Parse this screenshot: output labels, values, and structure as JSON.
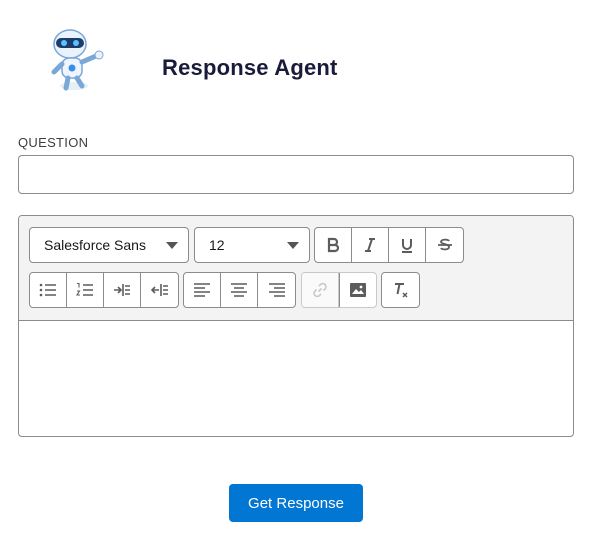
{
  "header": {
    "title": "Response Agent",
    "logo_icon": "robot-mascot-icon"
  },
  "question": {
    "label": "QUESTION",
    "value": "",
    "placeholder": ""
  },
  "editor": {
    "font_family_value": "Salesforce Sans",
    "font_size_value": "12",
    "toolbar_icons": [
      "bold-icon",
      "italic-icon",
      "underline-icon",
      "strikethrough-icon",
      "bulleted-list-icon",
      "numbered-list-icon",
      "indent-icon",
      "outdent-icon",
      "align-left-icon",
      "align-center-icon",
      "align-right-icon",
      "link-icon",
      "image-icon",
      "remove-formatting-icon"
    ],
    "body_text": ""
  },
  "submit": {
    "label": "Get Response"
  },
  "colors": {
    "brand_blue": "#0176d3",
    "title": "#1a1b3a",
    "border": "#8c8c8c",
    "toolbar_bg": "#f3f3f3"
  }
}
